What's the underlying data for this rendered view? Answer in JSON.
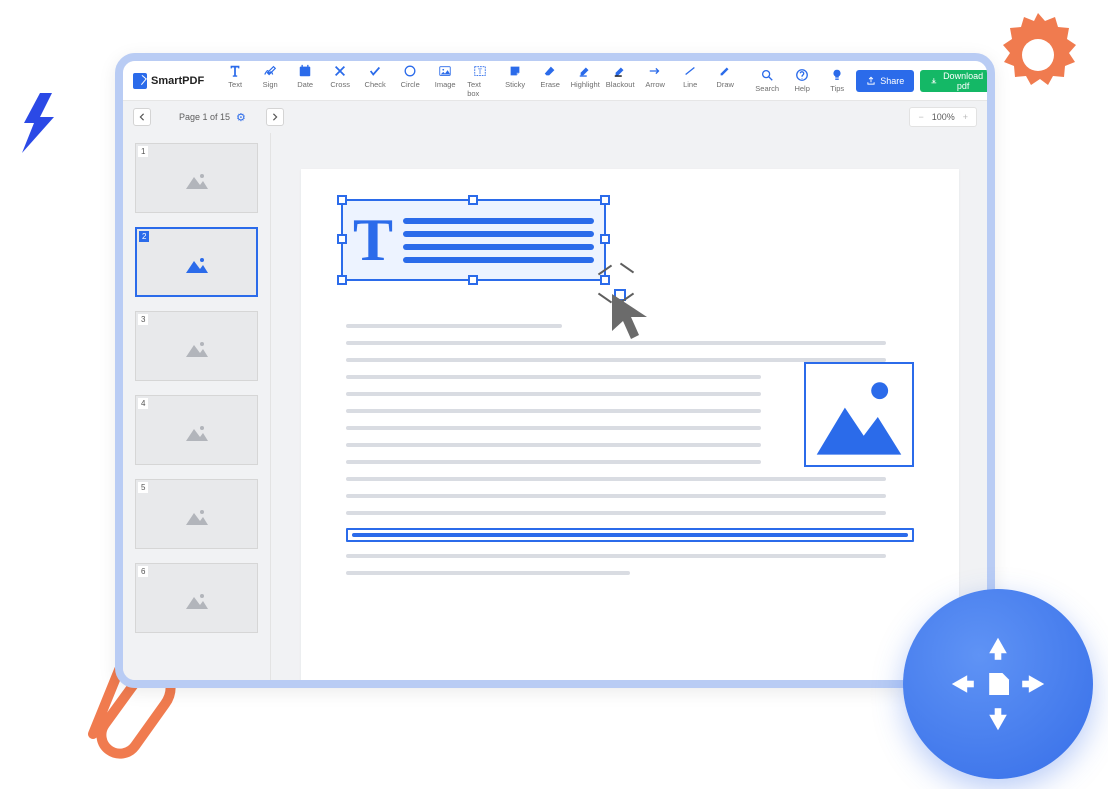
{
  "brand": {
    "name": "SmartPDF"
  },
  "toolbar": {
    "tools": [
      {
        "id": "text",
        "label": "Text"
      },
      {
        "id": "sign",
        "label": "Sign"
      },
      {
        "id": "date",
        "label": "Date"
      },
      {
        "id": "cross",
        "label": "Cross"
      },
      {
        "id": "check",
        "label": "Check"
      },
      {
        "id": "circle",
        "label": "Circle"
      },
      {
        "id": "image",
        "label": "Image"
      },
      {
        "id": "textbox",
        "label": "Text box"
      },
      {
        "id": "sticky",
        "label": "Sticky"
      },
      {
        "id": "erase",
        "label": "Erase"
      },
      {
        "id": "highlight",
        "label": "Highlight"
      },
      {
        "id": "blackout",
        "label": "Blackout"
      },
      {
        "id": "arrow",
        "label": "Arrow"
      },
      {
        "id": "line",
        "label": "Line"
      },
      {
        "id": "draw",
        "label": "Draw"
      }
    ],
    "right_tools": [
      {
        "id": "search",
        "label": "Search"
      },
      {
        "id": "help",
        "label": "Help"
      },
      {
        "id": "tips",
        "label": "Tips"
      }
    ],
    "share": "Share",
    "download": "Download pdf"
  },
  "paging": {
    "label": "Page 1 of 15",
    "pages": [
      1,
      2,
      3,
      4,
      5,
      6
    ],
    "active": 2
  },
  "zoom": {
    "label": "100%"
  }
}
